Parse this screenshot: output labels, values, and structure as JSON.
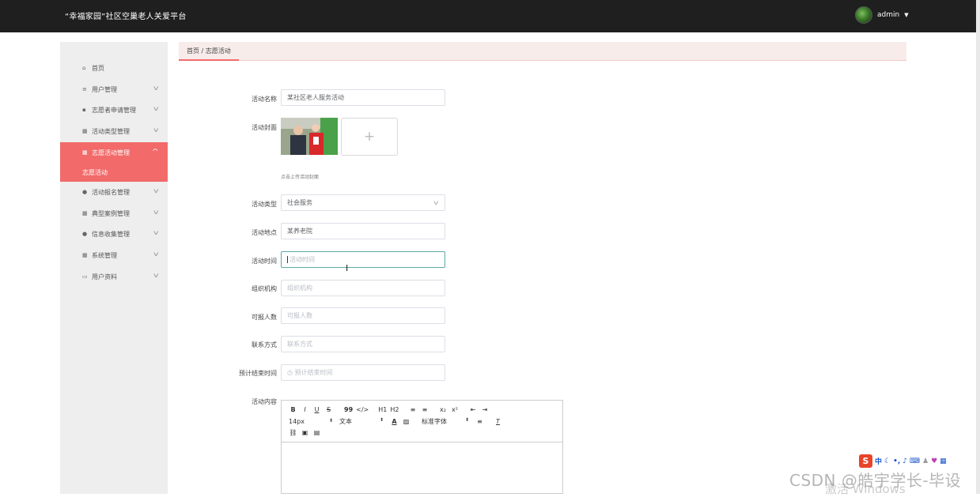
{
  "header": {
    "title": "“幸福家园”社区空巢老人关爱平台",
    "user": "admin"
  },
  "breadcrumb": {
    "text": "首页 / 志愿活动"
  },
  "sidebar": {
    "items": [
      {
        "label": "首页",
        "icon": "home-icon"
      },
      {
        "label": "用户管理",
        "icon": "list-icon"
      },
      {
        "label": "志愿者申请管理",
        "icon": "lock-icon"
      },
      {
        "label": "活动类型管理",
        "icon": "grid-icon"
      },
      {
        "label": "志愿活动管理",
        "icon": "grid-icon"
      },
      {
        "label": "活动报名管理",
        "icon": "user-icon"
      },
      {
        "label": "典型案例管理",
        "icon": "grid-icon"
      },
      {
        "label": "信息收集管理",
        "icon": "location-icon"
      },
      {
        "label": "系统管理",
        "icon": "grid-icon"
      },
      {
        "label": "用户资料",
        "icon": "card-icon"
      }
    ],
    "sub_active": "志愿活动"
  },
  "form": {
    "name_label": "活动名称",
    "name_value": "某社区老人服务活动",
    "cover_label": "活动封面",
    "cover_hint": "点击上传活动封面",
    "type_label": "活动类型",
    "type_value": "社会服务",
    "place_label": "活动地点",
    "place_value": "某养老院",
    "time_label": "活动时间",
    "time_placeholder": "活动时间",
    "org_label": "组织机构",
    "org_placeholder": "组织机构",
    "count_label": "可报人数",
    "count_placeholder": "可报人数",
    "contact_label": "联系方式",
    "contact_placeholder": "联系方式",
    "end_label": "预计结束时间",
    "end_placeholder": "预计结束时间",
    "content_label": "活动内容"
  },
  "editor": {
    "row1": [
      "B",
      "I",
      "U",
      "S",
      "99",
      "</>",
      "H1",
      "H2",
      "≡",
      "≡",
      "x₂",
      "x²",
      "⇤",
      "⇥"
    ],
    "font_size": "14px",
    "header_pick": "文本",
    "font_pick": "标准字体",
    "row3": [
      "🔗",
      "▣",
      "▤"
    ]
  },
  "watermark": {
    "csdn": "CSDN @皓宇学长-毕设",
    "windows": "激活 Windows"
  },
  "tray": {
    "ime": "中"
  }
}
